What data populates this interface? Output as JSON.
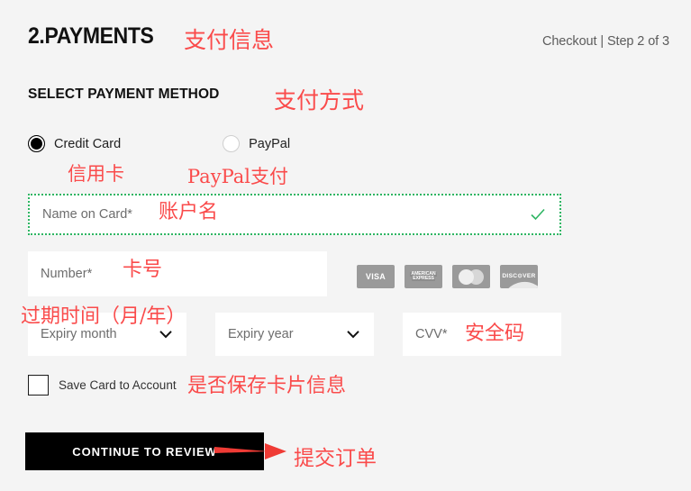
{
  "header": {
    "title": "2.PAYMENTS",
    "breadcrumb": "Checkout | Step 2 of 3"
  },
  "section": {
    "title": "SELECT PAYMENT METHOD"
  },
  "payment_methods": {
    "options": [
      {
        "label": "Credit Card",
        "selected": true
      },
      {
        "label": "PayPal",
        "selected": false
      }
    ]
  },
  "form": {
    "name_on_card": {
      "label": "Name on Card*",
      "value": "",
      "valid": true,
      "validation_icon": "check-icon"
    },
    "number": {
      "label": "Number*",
      "value": ""
    },
    "expiry_month": {
      "label": "Expiry month",
      "value": "",
      "icon": "chevron-down-icon"
    },
    "expiry_year": {
      "label": "Expiry year",
      "value": "",
      "icon": "chevron-down-icon"
    },
    "cvv": {
      "label": "CVV*",
      "value": ""
    },
    "save_card": {
      "label": "Save Card to Account",
      "checked": false
    }
  },
  "card_brands": [
    {
      "name": "visa-logo",
      "text": "VISA"
    },
    {
      "name": "amex-logo",
      "text_line1": "AMERICAN",
      "text_line2": "EXPRESS"
    },
    {
      "name": "mastercard-logo",
      "text": ""
    },
    {
      "name": "discover-logo",
      "text": "DISC⊙VER"
    }
  ],
  "actions": {
    "continue_label": "CONTINUE TO REVIEW"
  },
  "annotations": {
    "payments": "支付信息",
    "payment_method": "支付方式",
    "credit_card": "信用卡",
    "paypal": "PayPal支付",
    "name_on_card": "账户名",
    "number": "卡号",
    "expiry": "过期时间（月/年）",
    "cvv": "安全码",
    "save_card": "是否保存卡片信息",
    "submit": "提交订单"
  },
  "colors": {
    "background": "#f4f4f4",
    "field_background": "#ffffff",
    "annotation_red": "#fa4b4b",
    "valid_green": "#2eb563",
    "button_black": "#000000"
  }
}
